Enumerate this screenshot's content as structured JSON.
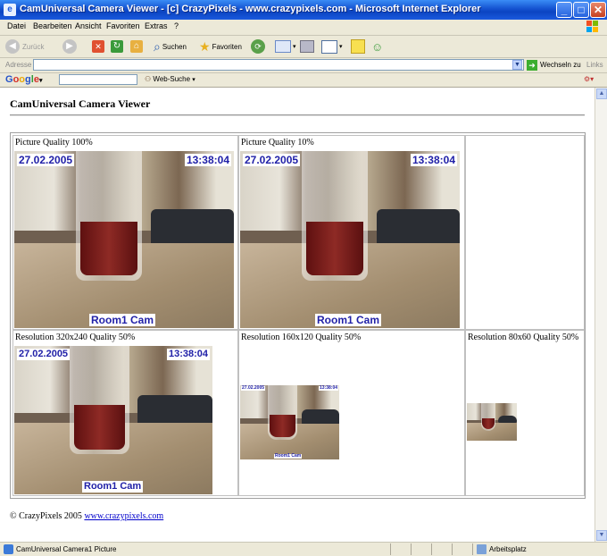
{
  "window": {
    "title": "CamUniversal Camera Viewer - [c] CrazyPixels - www.crazypixels.com - Microsoft Internet Explorer",
    "icon": "ie-icon",
    "controls": [
      "_",
      "□",
      "✕"
    ]
  },
  "menu": [
    "Datei",
    "Bearbeiten",
    "Ansicht",
    "Favoriten",
    "Extras",
    "?"
  ],
  "toolbar": {
    "back": "Zurück",
    "search": "Suchen",
    "favorites": "Favoriten"
  },
  "address": {
    "label": "Adresse",
    "value": "",
    "go": "Wechseln zu",
    "links": "Links"
  },
  "google": {
    "logo": "Google",
    "query": "",
    "websearch": "Web-Suche"
  },
  "page": {
    "title": "CamUniversal Camera Viewer",
    "cells": [
      {
        "label": "Picture Quality 100%"
      },
      {
        "label": "Picture Quality 10%"
      },
      {
        "label": ""
      },
      {
        "label": "Resolution 320x240 Quality 50%"
      },
      {
        "label": "Resolution 160x120 Quality 50%"
      },
      {
        "label": "Resolution 80x60 Quality 50%"
      }
    ],
    "overlay": {
      "date": "27.02.2005",
      "time": "13:38:04",
      "room": "Room1 Cam"
    },
    "footer": {
      "text": "© CrazyPixels 2005",
      "link": "www.crazypixels.com"
    }
  },
  "status": {
    "text": "CamUniversal Camera1 Picture",
    "zone": "Arbeitsplatz"
  },
  "colors": {
    "titlebar": "#1452d0",
    "overlay_text": "#2121a8",
    "link": "#0000cc"
  }
}
